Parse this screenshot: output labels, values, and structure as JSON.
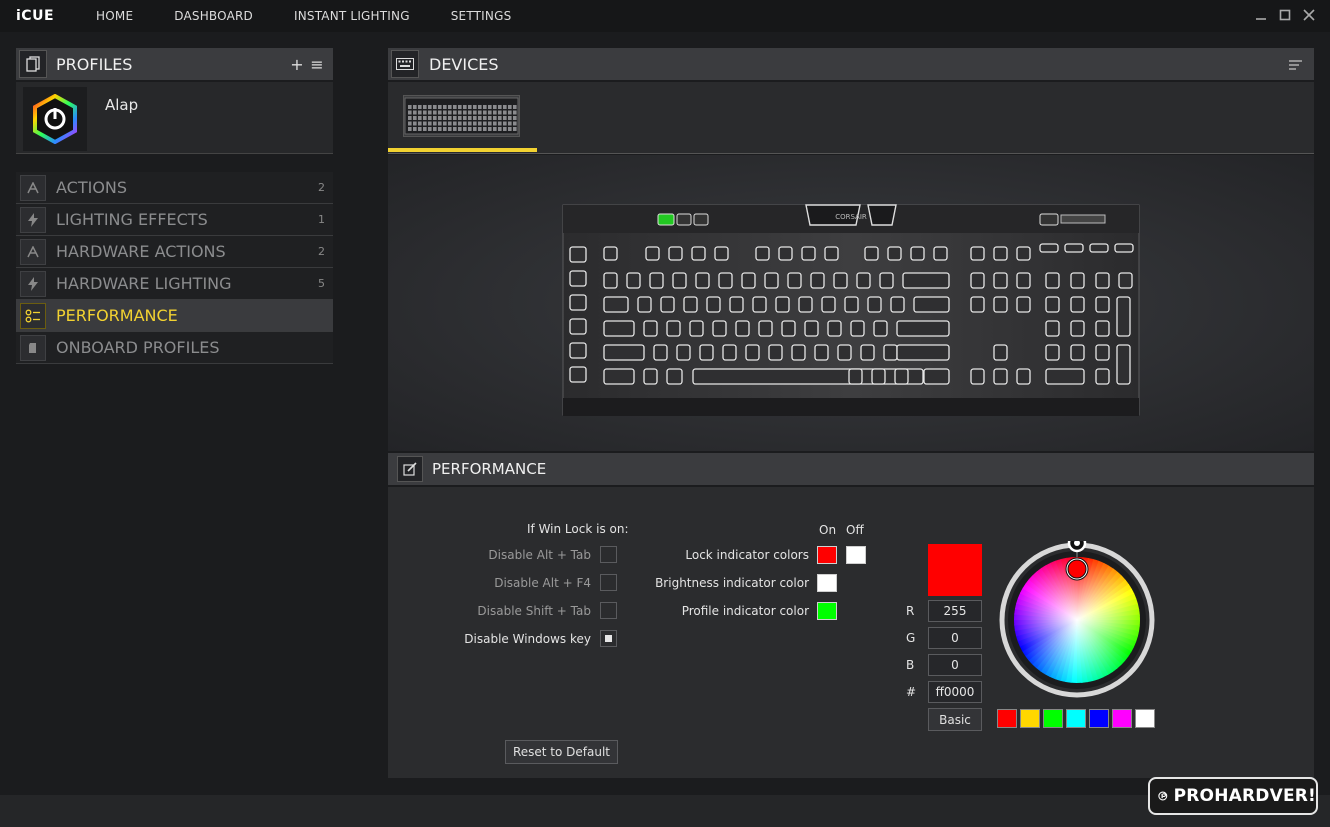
{
  "app": {
    "title": "iCUE"
  },
  "nav": [
    "HOME",
    "DASHBOARD",
    "INSTANT LIGHTING",
    "SETTINGS"
  ],
  "window_controls": {
    "minimize_icon": "minimize-icon",
    "maximize_icon": "maximize-icon",
    "close_icon": "close-icon"
  },
  "profiles": {
    "title": "PROFILES",
    "add_label": "+",
    "menu_label": "≡",
    "current": {
      "name": "Alap"
    }
  },
  "sidebar": {
    "items": [
      {
        "label": "ACTIONS",
        "count": "2",
        "icon": "letter-a-icon",
        "active": false
      },
      {
        "label": "LIGHTING EFFECTS",
        "count": "1",
        "icon": "lightning-icon",
        "active": false
      },
      {
        "label": "HARDWARE ACTIONS",
        "count": "2",
        "icon": "letter-a-icon",
        "active": false
      },
      {
        "label": "HARDWARE LIGHTING",
        "count": "5",
        "icon": "lightning-icon",
        "active": false
      },
      {
        "label": "PERFORMANCE",
        "count": "",
        "icon": "performance-icon",
        "active": true
      },
      {
        "label": "ONBOARD PROFILES",
        "count": "",
        "icon": "memory-icon",
        "active": false
      }
    ]
  },
  "devices": {
    "title": "DEVICES",
    "keyboard_brand": "CORSAIR"
  },
  "performance": {
    "title": "PERFORMANCE",
    "win_lock_heading": "If Win Lock is on:",
    "options": [
      {
        "label": "Disable Alt + Tab",
        "checked": false,
        "enabled": false
      },
      {
        "label": "Disable Alt + F4",
        "checked": false,
        "enabled": false
      },
      {
        "label": "Disable Shift + Tab",
        "checked": false,
        "enabled": false
      },
      {
        "label": "Disable Windows key",
        "checked": true,
        "enabled": true
      }
    ],
    "col_on": "On",
    "col_off": "Off",
    "indicators": [
      {
        "label": "Lock indicator colors",
        "on": "#ff0000",
        "off": "#ffffff"
      },
      {
        "label": "Brightness indicator color",
        "on": "#ffffff"
      },
      {
        "label": "Profile indicator color",
        "on": "#00ff00"
      }
    ],
    "reset_label": "Reset to Default"
  },
  "color_picker": {
    "current": "#ff0000",
    "r_label": "R",
    "g_label": "G",
    "b_label": "B",
    "hex_label": "#",
    "r": "255",
    "g": "0",
    "b": "0",
    "hex": "ff0000",
    "basic_label": "Basic",
    "presets": [
      "#ff0000",
      "#ffd700",
      "#00ff00",
      "#00ffff",
      "#0000ff",
      "#ff00ff",
      "#ffffff"
    ]
  },
  "watermark": {
    "text": "PROHARDVER!"
  },
  "colors": {
    "accent": "#f2d231",
    "header_bg": "#3b3c3f",
    "panel_bg": "#2b2c2e"
  }
}
